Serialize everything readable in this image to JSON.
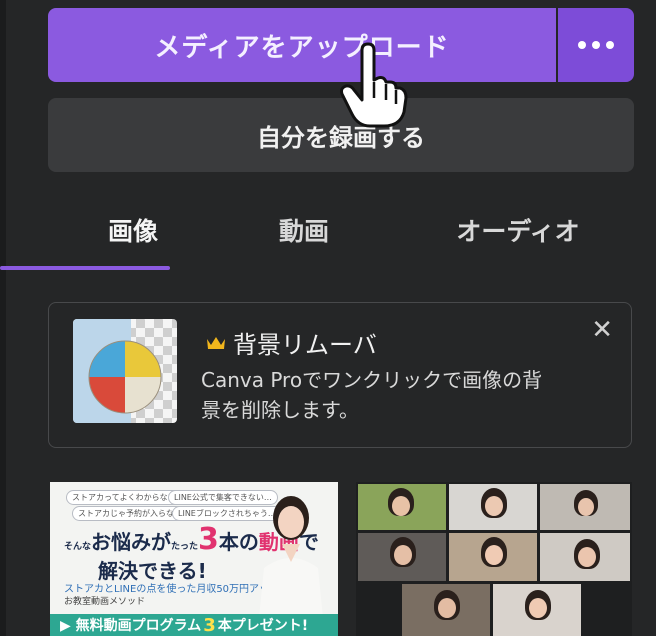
{
  "upload": {
    "label": "メディアをアップロード",
    "more_icon": "ellipsis-icon"
  },
  "record": {
    "label": "自分を録画する"
  },
  "tabs": [
    {
      "label": "画像",
      "active": true
    },
    {
      "label": "動画",
      "active": false
    },
    {
      "label": "オーディオ",
      "active": false
    }
  ],
  "promo": {
    "title": "背景リムーバ",
    "desc_line1": "Canva Proでワンクリックで画像の背",
    "desc_line2": "景を削除します。",
    "close_icon": "close-icon",
    "crown_icon": "crown-icon",
    "thumb": "beach-ball-image"
  },
  "media": {
    "thumb1": {
      "bubble1": "ストアカってよくわからない…",
      "bubble2": "LINE公式で集客できない…",
      "bubble3": "ストアカじゃ予約が入らない…",
      "bubble4": "LINEブロックされちゃう…",
      "tiny_sonna": "そんな",
      "line1a": "お悩みが",
      "tiny_tatta": "たった",
      "line1b": "本の",
      "line1c": "動画",
      "line1d": "で",
      "num": "3",
      "line2": "解決できる!",
      "sub": "ストアカとLINEの点を使った月収50万円アップ法",
      "sub2": "お教室動画メソッド",
      "banner_a": "▶ 無料動画プログラム",
      "banner_num": "3",
      "banner_b": "本プレゼント!"
    },
    "thumb2": {
      "desc": "zoom-group-photo"
    }
  },
  "colors": {
    "accent": "#8b5ae0",
    "bg": "#252627",
    "button": "#3a3b3d"
  }
}
